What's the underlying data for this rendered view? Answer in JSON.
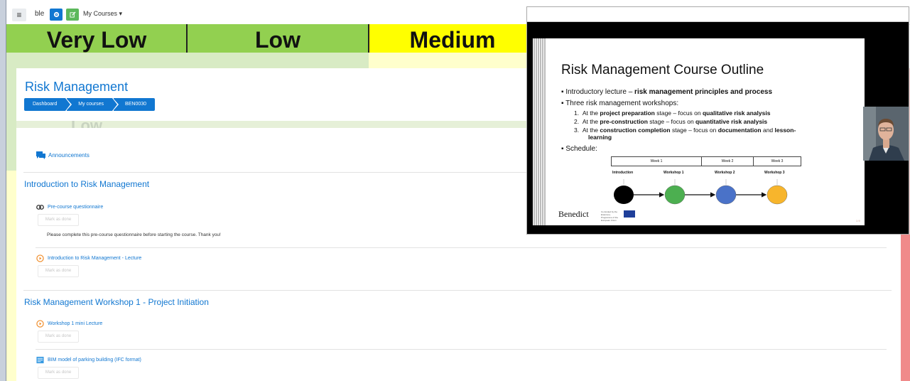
{
  "navbar": {
    "menu_icon": "hamburger-icon",
    "left_text": "ble",
    "btn1_icon": "cog-icon",
    "btn2_icon": "edit-icon",
    "my_courses": "My Courses"
  },
  "risk_table": {
    "cells": [
      "Very Low",
      "Low",
      "Medium"
    ],
    "under_text": "Low",
    "colors": {
      "green": "#92d050",
      "yellow": "#ffff00",
      "light_green": "#d8ebc4",
      "light_yellow": "#ffffcc",
      "pink": "#f4cccc",
      "red": "#f08a8a"
    }
  },
  "header": {
    "title": "Risk Management",
    "breadcrumb": [
      "Dashboard",
      "My courses",
      "BEN0030"
    ]
  },
  "content": {
    "announcements": "Announcements",
    "sections": [
      {
        "title": "Introduction to Risk Management",
        "activities": [
          {
            "label": "Pre-course questionnaire",
            "icon": "link-icon",
            "mark": "Mark as done",
            "note": "Please complete this pre-course questionnaire before starting the course. Thank you!"
          },
          {
            "label": "Introduction to Risk Management - Lecture",
            "icon": "play-icon",
            "mark": "Mark as done"
          }
        ]
      },
      {
        "title": "Risk Management Workshop 1 - Project Initiation",
        "activities": [
          {
            "label": "Workshop 1 mini Lecture",
            "icon": "play-icon",
            "mark": "Mark as done"
          },
          {
            "label": "BIM model of parking building (IFC format)",
            "icon": "file-icon",
            "mark": "Mark as done"
          }
        ]
      }
    ]
  },
  "slide": {
    "title": "Risk Management Course Outline",
    "bullet1_pre": "Introductory lecture – ",
    "bullet1_bold": "risk management principles and process",
    "bullet2": "Three risk management workshops:",
    "items": [
      {
        "num": "1.",
        "pre": "At the ",
        "b1": "project preparation",
        "mid": " stage – focus on ",
        "b2": "qualitative risk analysis",
        "post": ""
      },
      {
        "num": "2.",
        "pre": "At the ",
        "b1": "pre-construction",
        "mid": " stage – focus on ",
        "b2": "quantitative risk analysis",
        "post": ""
      },
      {
        "num": "3.",
        "pre": "At the ",
        "b1": "construction completion",
        "mid": " stage – focus on ",
        "b2": "documentation",
        "post": " and "
      }
    ],
    "item3_b3": "lesson-",
    "item3_line2": "learning",
    "bullet3": "Schedule:",
    "weeks": [
      "Week 1",
      "Week 2",
      "Week 3"
    ],
    "stages": [
      "Introduction",
      "Workshop 1",
      "Workshop 2",
      "Workshop 3"
    ],
    "circle_colors": [
      "#000000",
      "#4caf50",
      "#4a72c8",
      "#f7b52c"
    ],
    "logo_text": "Benedict",
    "eu_text": "Co-funded by the Erasmus+ Programme of the European Union",
    "page_num": "1 9"
  }
}
